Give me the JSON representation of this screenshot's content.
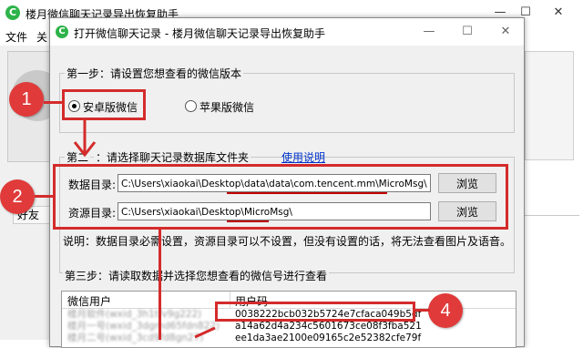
{
  "main_window": {
    "title": "楼月微信聊天记录导出恢复助手",
    "menu": [
      "文件",
      "关"
    ],
    "friends_header": "好友",
    "controls": {
      "minimize": "—",
      "maximize": "☐",
      "close": "✕"
    }
  },
  "dialog": {
    "title": "打开微信聊天记录 - 楼月微信聊天记录导出恢复助手",
    "controls": {
      "minimize": "—",
      "maximize": "☐",
      "close": "✕"
    },
    "step1": {
      "label": "第一步：请设置您想查看的微信版本",
      "options": [
        {
          "label": "安卓版微信",
          "checked": true
        },
        {
          "label": "苹果版微信",
          "checked": false
        }
      ]
    },
    "step2": {
      "label_visible_left": "第二",
      "label_visible_right": "：请选择聊天记录数据库文件夹",
      "help_link": "使用说明",
      "data_dir_label": "数据目录:",
      "data_dir_value": "C:\\Users\\xiaokai\\Desktop\\data\\data\\com.tencent.mm\\MicroMsg\\",
      "res_dir_label": "资源目录:",
      "res_dir_value": "C:\\Users\\xiaokai\\Desktop\\MicroMsg\\",
      "browse_label": "浏览",
      "note": "说明：数据目录必需设置，资源目录可以不设置，但没有设置的话，将无法查看图片及语音。"
    },
    "step3": {
      "label": "第三步：请读取数据并选择您想查看的微信号进行查看",
      "columns": [
        "微信用户",
        "用户码"
      ],
      "rows": [
        {
          "user": "楼月软件(wxid_3h1tfv9g222)",
          "code": "0038222bcb032b5724e7cfaca049b5df"
        },
        {
          "user": "楼月一号(wxid_3dgmd65fdn822)",
          "code": "a14a62d4a234c5601673ce08f3fba521"
        },
        {
          "user": "楼月二号(wxid_3cd9fd8gn27)",
          "code": "ee1da3ae2100e09165c2e52382cfe79f"
        }
      ]
    }
  },
  "annotations": {
    "badges": [
      "1",
      "2",
      "4"
    ],
    "color": "#d42b2b"
  }
}
